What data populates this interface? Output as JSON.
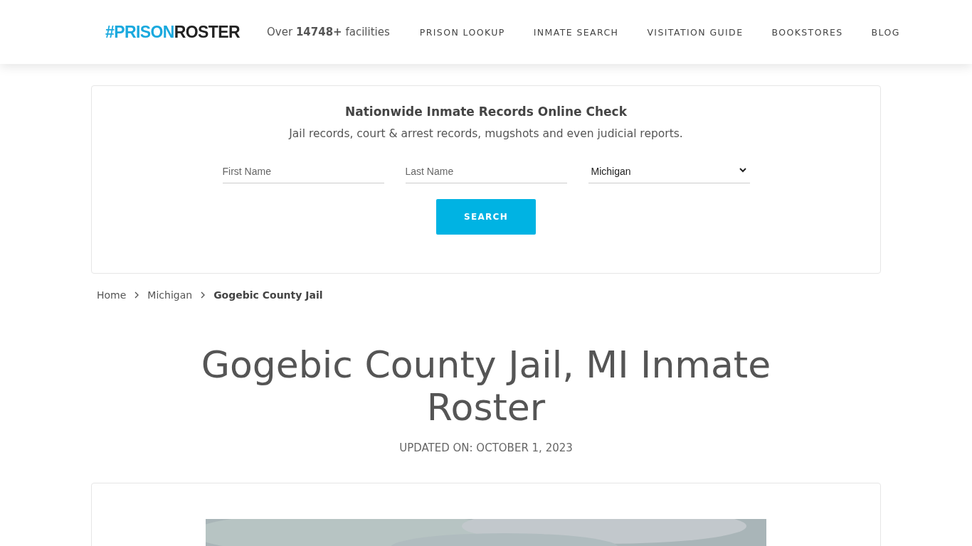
{
  "header": {
    "logo": {
      "part_1": "#PRISON",
      "part_2": "ROSTER"
    },
    "tagline": "Over **14748+** facilities",
    "nav": [
      "PRISON LOOKUP",
      "INMATE SEARCH",
      "VISITATION GUIDE",
      "BOOKSTORES",
      "BLOG"
    ]
  },
  "search_card": {
    "title": "Nationwide Inmate Records Online Check",
    "subtitle": "Jail records, court & arrest records, mugshots and even judicial reports.",
    "first_name": {
      "placeholder": "First Name"
    },
    "last_name": {
      "placeholder": "Last Name"
    },
    "state_select": {
      "value": "Michigan"
    },
    "button": "SEARCH"
  },
  "breadcrumb": [
    {
      "label": "Home",
      "current": false
    },
    {
      "label": "Michigan",
      "current": false
    },
    {
      "label": "Gogebic County Jail",
      "current": true
    }
  ],
  "page_title": "Gogebic County Jail, MI Inmate Roster",
  "updated": "UPDATED ON: OCTOBER 1, 2023"
}
